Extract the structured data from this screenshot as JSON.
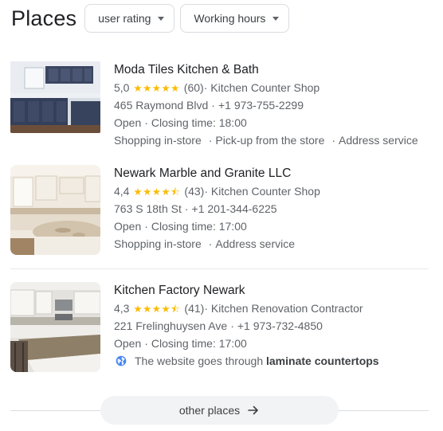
{
  "header": {
    "title": "Places",
    "filters": [
      {
        "label": "user rating"
      },
      {
        "label": "Working hours"
      }
    ]
  },
  "results": [
    {
      "name": "Moda Tiles Kitchen & Bath",
      "rating": "5,0",
      "stars": "★★★★★",
      "star_value": 5.0,
      "reviews": "(60)",
      "category": "· Kitchen Counter Shop",
      "address": "465 Raymond Blvd",
      "phone": "+1 973-755-2299",
      "status": "Open",
      "closing": "Closing time: 18:00",
      "services": [
        "Shopping in-store",
        "Pick-up from the store",
        "Address service"
      ]
    },
    {
      "name": "Newark Marble and Granite LLC",
      "rating": "4,4",
      "stars": "★★★★⯪",
      "star_value": 4.4,
      "reviews": "(43)",
      "category": "· Kitchen Counter Shop",
      "address": "763 S 18th St",
      "phone": "+1 201-344-6225",
      "status": "Open",
      "closing": "Closing time: 17:00",
      "services": [
        "Shopping in-store",
        "Address service"
      ]
    },
    {
      "name": "Kitchen Factory Newark",
      "rating": "4,3",
      "stars": "★★★★⯪",
      "star_value": 4.3,
      "reviews": "(41)",
      "category": "· Kitchen Renovation Contractor",
      "address": "221 Frelinghuysen Ave",
      "phone": "+1 973-732-4850",
      "status": "Open",
      "closing": "Closing time: 17:00",
      "website_note_prefix": "The website goes through",
      "website_note_bold": "laminate countertops"
    }
  ],
  "more": {
    "label": "other places"
  },
  "colors": {
    "star": "#fbbc04",
    "text_muted": "#5f6368",
    "link_blue": "#1a73e8"
  }
}
